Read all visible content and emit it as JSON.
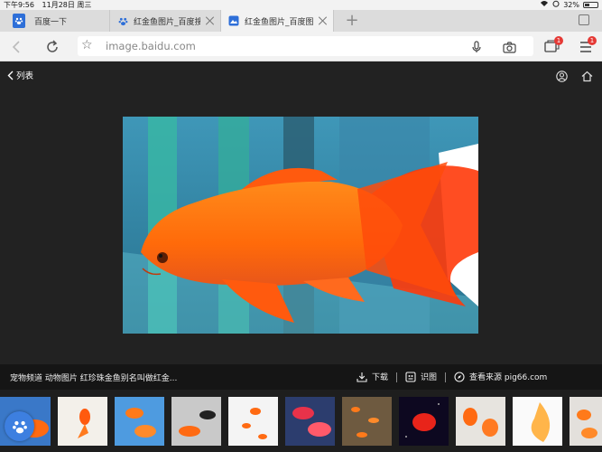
{
  "status_bar": {
    "time": "下午9:56",
    "date": "11月28日 周三",
    "battery": "32%"
  },
  "tabs": [
    {
      "label": "百度一下",
      "active": false
    },
    {
      "label": "红金鱼图片_百度搜索",
      "active": false
    },
    {
      "label": "红金鱼图片_百度图片",
      "active": true
    }
  ],
  "address_bar": {
    "url": "image.baidu.com",
    "tabs_badge": "1",
    "menu_badge": "1"
  },
  "viewer": {
    "back_label": "列表"
  },
  "caption": {
    "text": "宠物频道 动物图片 红珍珠金鱼别名叫做红金...",
    "download_label": "下载",
    "recognize_label": "识图",
    "source_label": "查看来源 pig66.com"
  },
  "thumbnails": [
    {
      "name": "thumb-1",
      "bg": "#3a78c8"
    },
    {
      "name": "thumb-2",
      "bg": "#f3f0ea"
    },
    {
      "name": "thumb-3",
      "bg": "#4e9be0"
    },
    {
      "name": "thumb-4",
      "bg": "#c9c9c9"
    },
    {
      "name": "thumb-5",
      "bg": "#f4f4f4"
    },
    {
      "name": "thumb-6",
      "bg": "#2c3d6e"
    },
    {
      "name": "thumb-7",
      "bg": "#6e5a40"
    },
    {
      "name": "thumb-8",
      "bg": "#0d0820"
    },
    {
      "name": "thumb-9",
      "bg": "#e7e4df"
    },
    {
      "name": "thumb-10",
      "bg": "#fafafa"
    },
    {
      "name": "thumb-11",
      "bg": "#e3e0dc"
    }
  ],
  "colors": {
    "accent_blue": "#3d7fe0",
    "badge_red": "#e53935",
    "viewer_bg": "#222222"
  }
}
